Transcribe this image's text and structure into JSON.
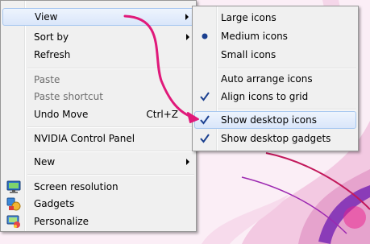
{
  "context_menu": {
    "items": [
      {
        "label": "View",
        "has_submenu": true,
        "highlighted": true
      },
      {
        "label": "Sort by",
        "has_submenu": true
      },
      {
        "label": "Refresh"
      },
      {
        "label": "Paste",
        "disabled": true
      },
      {
        "label": "Paste shortcut",
        "disabled": true
      },
      {
        "label": "Undo Move",
        "accel": "Ctrl+Z"
      },
      {
        "label": "NVIDIA Control Panel"
      },
      {
        "label": "New",
        "has_submenu": true
      },
      {
        "label": "Screen resolution",
        "icon": "monitor-icon"
      },
      {
        "label": "Gadgets",
        "icon": "gadgets-icon"
      },
      {
        "label": "Personalize",
        "icon": "personalize-icon"
      }
    ]
  },
  "view_submenu": {
    "items": [
      {
        "label": "Large icons"
      },
      {
        "label": "Medium icons",
        "selected": true
      },
      {
        "label": "Small icons"
      },
      {
        "label": "Auto arrange icons"
      },
      {
        "label": "Align icons to grid",
        "checked": true
      },
      {
        "label": "Show desktop icons",
        "checked": true,
        "highlighted": true
      },
      {
        "label": "Show desktop gadgets",
        "checked": true
      }
    ]
  },
  "colors": {
    "annotation_arrow": "#e0197a",
    "highlight_border": "#a8c8f0",
    "menu_background": "#f0f0f0",
    "check_mark": "#1a3f8f"
  }
}
